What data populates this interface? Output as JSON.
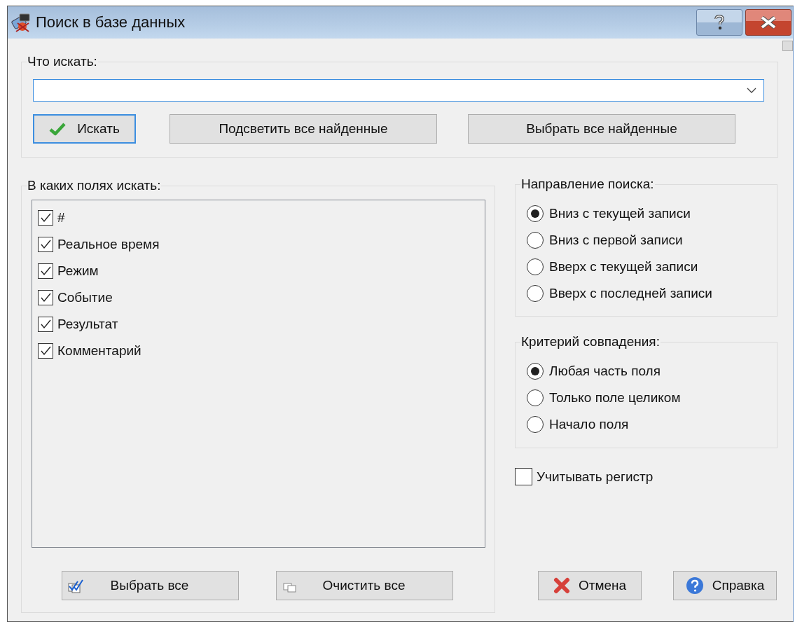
{
  "window": {
    "title": "Поиск в базе данных"
  },
  "query": {
    "label": "Что искать:"
  },
  "search_buttons": [
    {
      "label": "Искать",
      "kind": "check",
      "focused": true
    },
    {
      "label": "Подсветить все найденные",
      "kind": "plain",
      "focused": false
    },
    {
      "label": "Выбрать все найденные",
      "kind": "plain",
      "focused": false
    }
  ],
  "fields": {
    "label": "В каких полях искать:",
    "items": [
      {
        "label": "#",
        "checked": true
      },
      {
        "label": "Реальное время",
        "checked": true
      },
      {
        "label": "Режим",
        "checked": true
      },
      {
        "label": "Событие",
        "checked": true
      },
      {
        "label": "Результат",
        "checked": true
      },
      {
        "label": "Комментарий",
        "checked": true
      }
    ]
  },
  "list_buttons": [
    {
      "label": "Выбрать все",
      "kind": "check-all"
    },
    {
      "label": "Очистить все",
      "kind": "clear-all"
    }
  ],
  "direction": {
    "label": "Направление поиска:",
    "options": [
      {
        "label": "Вниз с текущей записи",
        "selected": true
      },
      {
        "label": "Вниз с первой записи",
        "selected": false
      },
      {
        "label": "Вверх с текущей записи",
        "selected": false
      },
      {
        "label": "Вверх с последней записи",
        "selected": false
      }
    ]
  },
  "match": {
    "label": "Критерий совпадения:",
    "options": [
      {
        "label": "Любая часть поля",
        "selected": true
      },
      {
        "label": "Только поле целиком",
        "selected": false
      },
      {
        "label": "Начало поля",
        "selected": false
      }
    ]
  },
  "case_sensitive": {
    "label": "Учитывать регистр",
    "checked": false
  },
  "dialog_buttons": [
    {
      "label": "Отмена",
      "kind": "cancel"
    },
    {
      "label": "Справка",
      "kind": "help"
    }
  ]
}
